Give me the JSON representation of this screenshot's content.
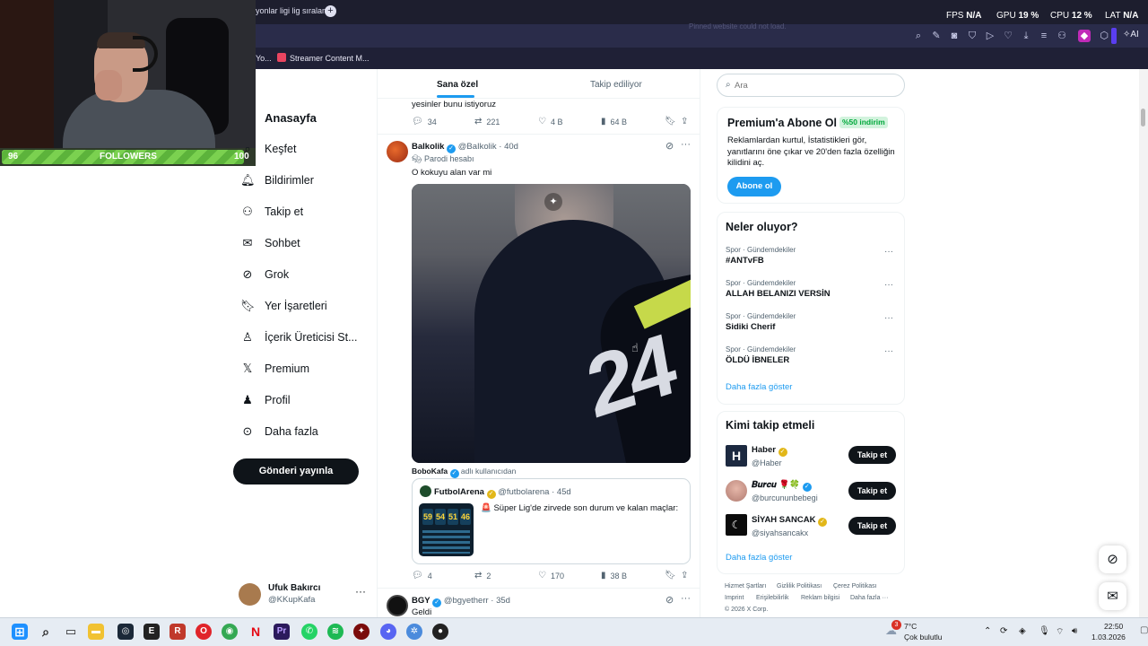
{
  "browser": {
    "tab_title": "yonlar ligi lig sıralam",
    "new_tab": "+",
    "toolbar_faded": "Pinned website could not load.",
    "bookmarks": [
      "Yo...",
      "Streamer Content M..."
    ],
    "hud": {
      "fps_label": "FPS",
      "fps_value": "N/A",
      "gpu_label": "GPU",
      "gpu_value": "19 %",
      "cpu_label": "CPU",
      "cpu_value": "12 %",
      "lat_label": "LAT",
      "lat_value": "N/A"
    },
    "ai_label": "AI"
  },
  "overlay": {
    "followers_left": "96",
    "followers_label": "FOLLOWERS",
    "followers_right": "100",
    "followers_progress": 0.96
  },
  "nav": {
    "home": "Anasayfa",
    "items": [
      {
        "label": "Keşfet",
        "icon": "search-icon"
      },
      {
        "label": "Bildirimler",
        "icon": "bell-icon"
      },
      {
        "label": "Takip et",
        "icon": "follow-icon"
      },
      {
        "label": "Sohbet",
        "icon": "mail-icon"
      },
      {
        "label": "Grok",
        "icon": "grok-icon"
      },
      {
        "label": "Yer İşaretleri",
        "icon": "bookmark-icon"
      },
      {
        "label": "İçerik Üreticisi St...",
        "icon": "creator-icon"
      },
      {
        "label": "Premium",
        "icon": "x-logo-icon"
      },
      {
        "label": "Profil",
        "icon": "person-icon"
      },
      {
        "label": "Daha fazla",
        "icon": "more-circle-icon"
      }
    ],
    "post_button": "Gönderi yayınla",
    "account": {
      "name": "Ufuk Bakırcı",
      "handle": "@KKupKafa",
      "more": "···"
    }
  },
  "feed": {
    "tabs": [
      "Sana özel",
      "Takip ediliyor"
    ],
    "prev_post": {
      "text": "yesinler bunu istiyoruz",
      "replies": "34",
      "reposts": "221",
      "likes": "4 B",
      "views": "64 B"
    },
    "post": {
      "name": "Balkolik",
      "handle": "@BaIkolik",
      "time": "· 40d",
      "parody": "Parodi hesabı",
      "text": "O kokuyu alan var mi",
      "jersey_number": "24",
      "credit_name": "BoboKafa",
      "credit_suffix": "adlı kullanıcıdan",
      "quote": {
        "name": "FutbolArena",
        "handle": "@futbolarena",
        "time": "· 45d",
        "text": "🚨 Süper Lig'de zirvede son durum ve kalan maçlar:",
        "scores": [
          "59",
          "54",
          "51",
          "46"
        ]
      },
      "replies": "4",
      "reposts": "2",
      "likes": "170",
      "views": "38 B"
    },
    "next_post": {
      "name": "BGY",
      "handle": "@bgyetherr",
      "time": "· 35d",
      "text": "Geldi"
    }
  },
  "sidebar": {
    "search_placeholder": "Ara",
    "premium": {
      "title": "Premium'a Abone Ol",
      "badge": "%50 indirim",
      "desc": "Reklamlardan kurtul, İstatistikleri gör, yanıtlarını öne çıkar ve 20'den fazla özelliğin kilidini aç.",
      "button": "Abone ol"
    },
    "trends_title": "Neler oluyor?",
    "trends": [
      {
        "category": "Spor · Gündemdekiler",
        "name": "#ANTvFB"
      },
      {
        "category": "Spor · Gündemdekiler",
        "name": "ALLAH BELANIZI VERSİN"
      },
      {
        "category": "Spor · Gündemdekiler",
        "name": "Sidiki Cherif"
      },
      {
        "category": "Spor · Gündemdekiler",
        "name": "ÖLDÜ İBNELER"
      }
    ],
    "trends_more": "Daha fazla göster",
    "who_title": "Kimi takip etmeli",
    "who": [
      {
        "name": "Haber",
        "handle": "@Haber",
        "button": "Takip et",
        "avatar_letter": "H"
      },
      {
        "name": "𝑩𝒖𝒓𝒄𝒖 🌹🍀",
        "handle": "@burcununbebegi",
        "button": "Takip et",
        "avatar_letter": ""
      },
      {
        "name": "SİYAH SANCAK",
        "handle": "@siyahsancakx",
        "button": "Takip et",
        "avatar_letter": "☾"
      }
    ],
    "who_more": "Daha fazla göster",
    "footer": [
      "Hizmet Şartları",
      "Gizlilik Politikası",
      "Çerez Politikası",
      "Imprint",
      "Erişilebilirlik",
      "Reklam bilgisi",
      "Daha fazla ···",
      "© 2026 X Corp."
    ]
  },
  "taskbar": {
    "weather_badge": "3",
    "temp": "7°C",
    "weather": "Çok bulutlu",
    "time": "22:50",
    "date": "1.03.2026"
  }
}
